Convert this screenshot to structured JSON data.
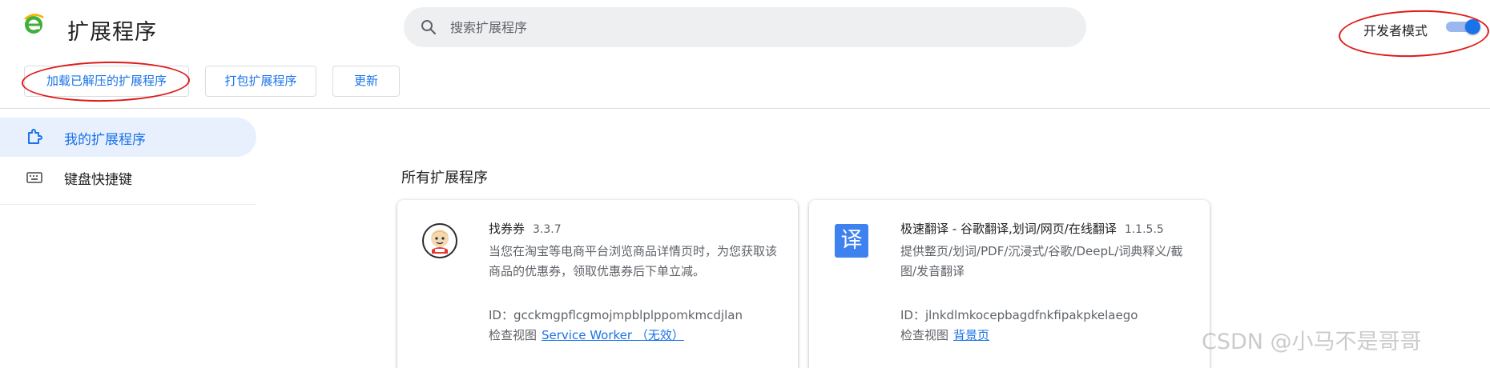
{
  "app": {
    "title": "扩展程序",
    "logo_icon": "ie-logo-icon"
  },
  "search": {
    "placeholder": "搜索扩展程序",
    "value": ""
  },
  "dev_mode": {
    "label": "开发者模式",
    "enabled": true,
    "accent": "#1a73e8"
  },
  "toolbar": {
    "load_unpacked": "加载已解压的扩展程序",
    "pack": "打包扩展程序",
    "update": "更新"
  },
  "sidebar": {
    "items": [
      {
        "label": "我的扩展程序",
        "icon": "puzzle-icon",
        "active": true
      },
      {
        "label": "键盘快捷键",
        "icon": "keyboard-icon",
        "active": false
      }
    ]
  },
  "main": {
    "section_title": "所有扩展程序",
    "extensions": [
      {
        "name": "找券券",
        "version": "3.3.7",
        "description": "当您在淘宝等电商平台浏览商品详情页时，为您获取该商品的优惠券，领取优惠券后下单立减。",
        "id_label": "ID：",
        "id": "gcckmgpflcgmojmpblplppomkmcdjlan",
        "inspect_label": "检查视图",
        "inspect_link": "Service Worker （无效）",
        "icon": "mascot-icon"
      },
      {
        "name": "极速翻译 - 谷歌翻译,划词/网页/在线翻译",
        "version": "1.1.5.5",
        "description": "提供整页/划词/PDF/沉浸式/谷歌/DeepL/词典释义/截图/发音翻译",
        "id_label": "ID：",
        "id": "jlnkdlmkocepbagdfnkfipakpkelaego",
        "inspect_label": "检查视图",
        "inspect_link": "背景页",
        "icon": "translate-icon",
        "icon_glyph": "译"
      }
    ]
  },
  "watermark": "CSDN @小马不是哥哥"
}
